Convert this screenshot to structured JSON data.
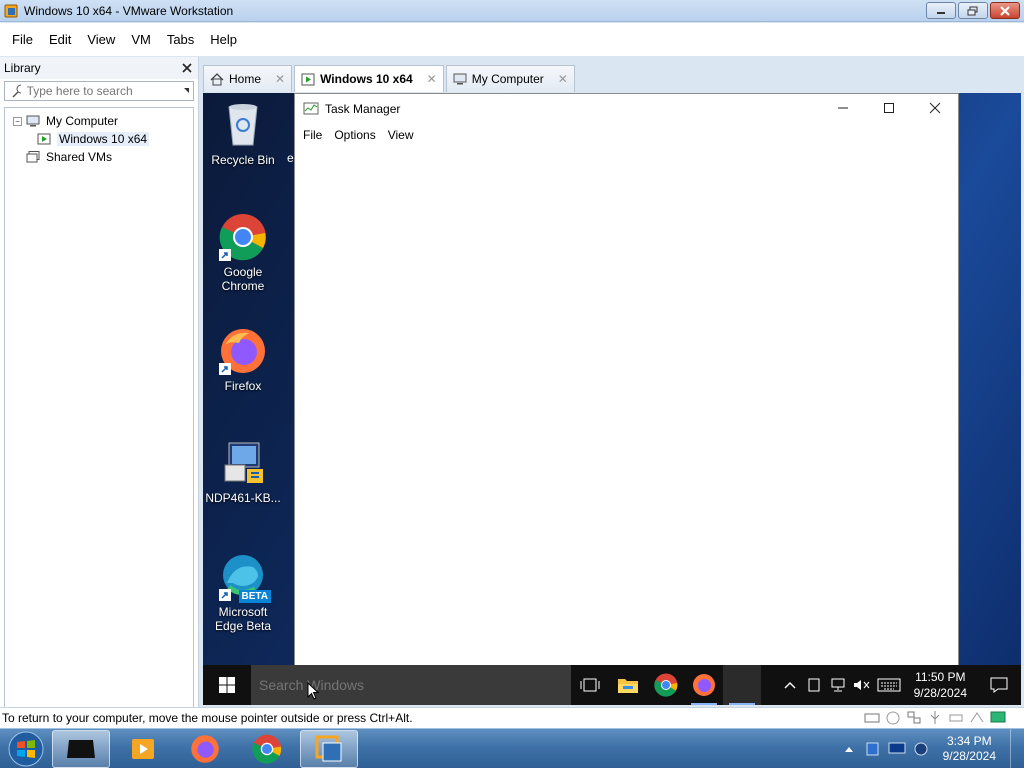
{
  "window": {
    "title": "Windows 10 x64 - VMware Workstation",
    "icon": "vmware-icon"
  },
  "menubar": [
    "File",
    "Edit",
    "View",
    "VM",
    "Tabs",
    "Help"
  ],
  "library": {
    "title": "Library",
    "search_placeholder": "Type here to search",
    "tree": [
      {
        "label": "My Computer",
        "icon": "computer-icon"
      },
      {
        "label": "Windows 10 x64",
        "icon": "vm-running-icon"
      },
      {
        "label": "Shared VMs",
        "icon": "shared-vms-icon"
      }
    ]
  },
  "tabs": [
    {
      "label": "Home",
      "icon": "home-icon"
    },
    {
      "label": "Windows 10 x64",
      "icon": "vm-running-icon"
    },
    {
      "label": "My Computer",
      "icon": "computer-icon"
    }
  ],
  "desktop": {
    "icons": [
      {
        "label": "Recycle Bin"
      },
      {
        "label": "Google Chrome"
      },
      {
        "label": "Firefox"
      },
      {
        "label": "NDP461-KB..."
      },
      {
        "label": "Microsoft Edge Beta",
        "badge": "BETA"
      }
    ],
    "partial_label": "e"
  },
  "task_manager": {
    "title": "Task Manager",
    "menu": [
      "File",
      "Options",
      "View"
    ]
  },
  "guest_taskbar": {
    "search_placeholder": "Search Windows",
    "clock_time": "11:50 PM",
    "clock_date": "9/28/2024"
  },
  "status_bar": {
    "message": "To return to your computer, move the mouse pointer outside or press Ctrl+Alt."
  },
  "host_taskbar": {
    "clock_time": "3:34 PM",
    "clock_date": "9/28/2024"
  },
  "colors": {
    "vm_titlebar": "#cfe0f4",
    "desktop_bg": "#0e2a5e",
    "guest_taskbar": "#101010",
    "host_taskbar": "#3f72a8"
  }
}
